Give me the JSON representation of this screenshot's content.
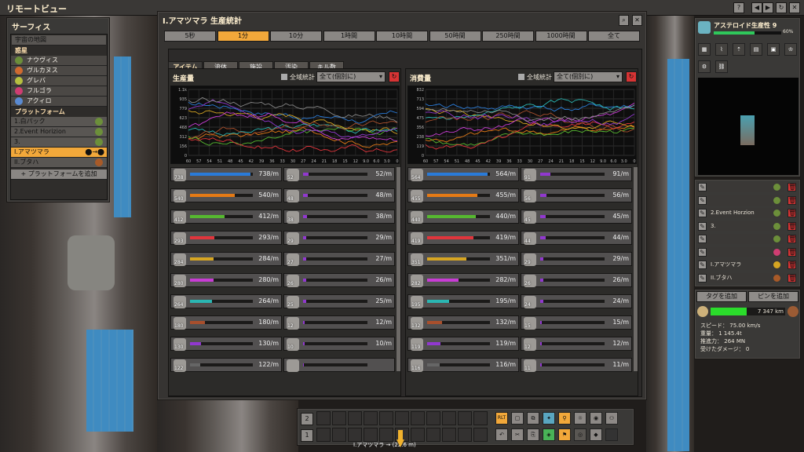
{
  "window": {
    "title": "リモートビュー",
    "controls": [
      "?",
      "◀",
      "▶",
      "↻",
      "✕"
    ]
  },
  "left": {
    "title": "サーフィス",
    "map": "宇宙の地図",
    "planet_section": "惑星",
    "planets": [
      {
        "name": "ナウヴィス",
        "color": "#6c8f3a"
      },
      {
        "name": "ヴルカヌス",
        "color": "#d06a30"
      },
      {
        "name": "グレバ",
        "color": "#b6c040"
      },
      {
        "name": "フルゴラ",
        "color": "#cf3d72"
      },
      {
        "name": "アクィロ",
        "color": "#5a8ad1"
      }
    ],
    "platform_section": "プラットフォーム",
    "platforms": [
      "1.白パック",
      "2.Event Horizion",
      "3.",
      "I.アマツマラ",
      "II.ブタハ"
    ],
    "add": "+ プラットフォームを追加"
  },
  "stats": {
    "title": "I.アマツマラ 生産統計",
    "timeframes": [
      "5秒",
      "1分",
      "10分",
      "1時間",
      "10時間",
      "50時間",
      "250時間",
      "1000時間",
      "全て"
    ],
    "selected": 1,
    "tabs": [
      "アイテム",
      "流体",
      "施設",
      "汚染",
      "キル数"
    ],
    "production": "生産量",
    "consumption": "消費量",
    "global": "全域統計",
    "filter": "全て(個別に)",
    "prod_left": [
      {
        "n": "738",
        "v": "738/m",
        "c": "#2a7bd8",
        "p": 0.96
      },
      {
        "n": "540",
        "v": "540/m",
        "c": "#e57a15",
        "p": 0.71
      },
      {
        "n": "412",
        "v": "412/m",
        "c": "#56b830",
        "p": 0.55
      },
      {
        "n": "293",
        "v": "293/m",
        "c": "#e0353c",
        "p": 0.39
      },
      {
        "n": "284",
        "v": "284/m",
        "c": "#d6a522",
        "p": 0.37
      },
      {
        "n": "280",
        "v": "280/m",
        "c": "#c83cd5",
        "p": 0.37
      },
      {
        "n": "264",
        "v": "264/m",
        "c": "#2ab6b2",
        "p": 0.35
      },
      {
        "n": "180",
        "v": "180/m",
        "c": "#a84f2c",
        "p": 0.24
      },
      {
        "n": "130",
        "v": "130/m",
        "c": "#9138cf",
        "p": 0.18
      },
      {
        "n": "122",
        "v": "122/m",
        "c": "#666",
        "p": 0.16
      }
    ],
    "prod_right": [
      {
        "n": "52",
        "v": "52/m",
        "p": 0.08
      },
      {
        "n": "48",
        "v": "48/m",
        "p": 0.07
      },
      {
        "n": "38",
        "v": "38/m",
        "p": 0.06
      },
      {
        "n": "29",
        "v": "29/m",
        "p": 0.05
      },
      {
        "n": "27",
        "v": "27/m",
        "p": 0.05
      },
      {
        "n": "26",
        "v": "26/m",
        "p": 0.05
      },
      {
        "n": "25",
        "v": "25/m",
        "p": 0.05
      },
      {
        "n": "12",
        "v": "12/m",
        "p": 0.03
      },
      {
        "n": "10",
        "v": "10/m",
        "p": 0.02
      },
      {
        "n": "",
        "v": "",
        "p": 0.01
      }
    ],
    "cons_left": [
      {
        "n": "564",
        "v": "564/m",
        "c": "#2a7bd8",
        "p": 0.96
      },
      {
        "n": "455",
        "v": "455/m",
        "c": "#e57a15",
        "p": 0.8
      },
      {
        "n": "440",
        "v": "440/m",
        "c": "#56b830",
        "p": 0.78
      },
      {
        "n": "419",
        "v": "419/m",
        "c": "#e0353c",
        "p": 0.74
      },
      {
        "n": "351",
        "v": "351/m",
        "c": "#d6a522",
        "p": 0.62
      },
      {
        "n": "282",
        "v": "282/m",
        "c": "#c83cd5",
        "p": 0.5
      },
      {
        "n": "195",
        "v": "195/m",
        "c": "#2ab6b2",
        "p": 0.35
      },
      {
        "n": "132",
        "v": "132/m",
        "c": "#a84f2c",
        "p": 0.24
      },
      {
        "n": "119",
        "v": "119/m",
        "c": "#9138cf",
        "p": 0.21
      },
      {
        "n": "116",
        "v": "116/m",
        "c": "#666",
        "p": 0.2
      }
    ],
    "cons_right": [
      {
        "n": "91",
        "v": "91/m",
        "p": 0.16
      },
      {
        "n": "56",
        "v": "56/m",
        "p": 0.1
      },
      {
        "n": "45",
        "v": "45/m",
        "p": 0.08
      },
      {
        "n": "44",
        "v": "44/m",
        "p": 0.08
      },
      {
        "n": "29",
        "v": "29/m",
        "p": 0.05
      },
      {
        "n": "26",
        "v": "26/m",
        "p": 0.05
      },
      {
        "n": "24",
        "v": "24/m",
        "p": 0.05
      },
      {
        "n": "15",
        "v": "15/m",
        "p": 0.03
      },
      {
        "n": "12",
        "v": "12/m",
        "p": 0.03
      },
      {
        "n": "11",
        "v": "11/m",
        "p": 0.02
      }
    ],
    "yticks_prod": [
      "1.1k",
      "935",
      "779",
      "623",
      "468",
      "312",
      "156",
      "0"
    ],
    "yticks_cons": [
      "832",
      "713",
      "594",
      "475",
      "356",
      "238",
      "119",
      "0"
    ],
    "xticks": [
      "60",
      "57",
      "54",
      "51",
      "48",
      "45",
      "42",
      "39",
      "36",
      "33",
      "30",
      "27",
      "24",
      "21",
      "18",
      "15",
      "12",
      "9.0",
      "6.0",
      "3.0",
      "0"
    ]
  },
  "right": {
    "research": "アステロイド生産性 9",
    "research_pct": "60%",
    "platforms": [
      "",
      "",
      "2.Event Horzion",
      "3.",
      "",
      "",
      "I.アマツマラ",
      "II.ブタハ"
    ],
    "add_tag": "タグを追加",
    "add_pin": "ピンを追加",
    "distance": "7 347 km",
    "speed": "スピード：",
    "speed_val": "75.00 km/s",
    "weight": "重量：",
    "weight_val": "1 145.4t",
    "thrust": "推進力：",
    "thrust_val": "264 MN",
    "damage": "受けたダメージ：",
    "damage_val": "0"
  },
  "bottom": {
    "rows": [
      "2",
      "1"
    ],
    "location": "I.アマツマラ",
    "distance": "(22.6 m)",
    "rlt": "RLT"
  }
}
